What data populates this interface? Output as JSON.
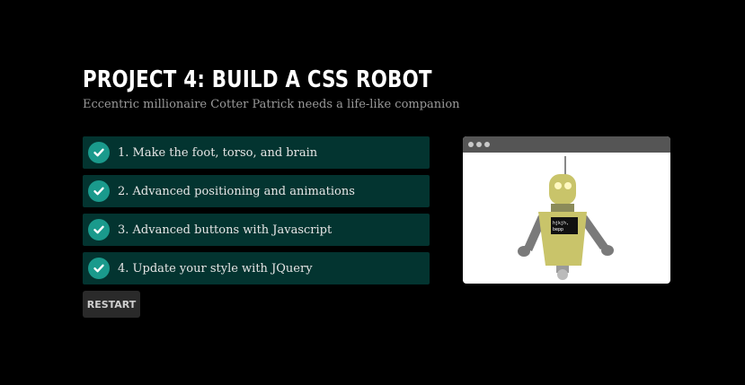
{
  "header": {
    "title": "PROJECT 4: BUILD A CSS ROBOT",
    "subtitle": "Eccentric millionaire Cotter Patrick needs a life-like companion"
  },
  "tasks": [
    {
      "label": "1. Make the foot, torso, and brain",
      "complete": true
    },
    {
      "label": "2. Advanced positioning and animations",
      "complete": true
    },
    {
      "label": "3. Advanced buttons with Javascript",
      "complete": true
    },
    {
      "label": "4. Update your style with JQuery",
      "complete": true
    }
  ],
  "restart_label": "RESTART",
  "preview": {
    "robot_screen_line1": "hjkjh,",
    "robot_screen_line2": "bepp"
  },
  "colors": {
    "background": "#000000",
    "task_bg": "#033430",
    "check_bg": "#1a9a8c",
    "robot_body": "#c9c46a",
    "robot_arm": "#7a7a7a"
  },
  "icons": {
    "task_check": "check-circle-icon",
    "window_dots": "window-dots-icon"
  }
}
